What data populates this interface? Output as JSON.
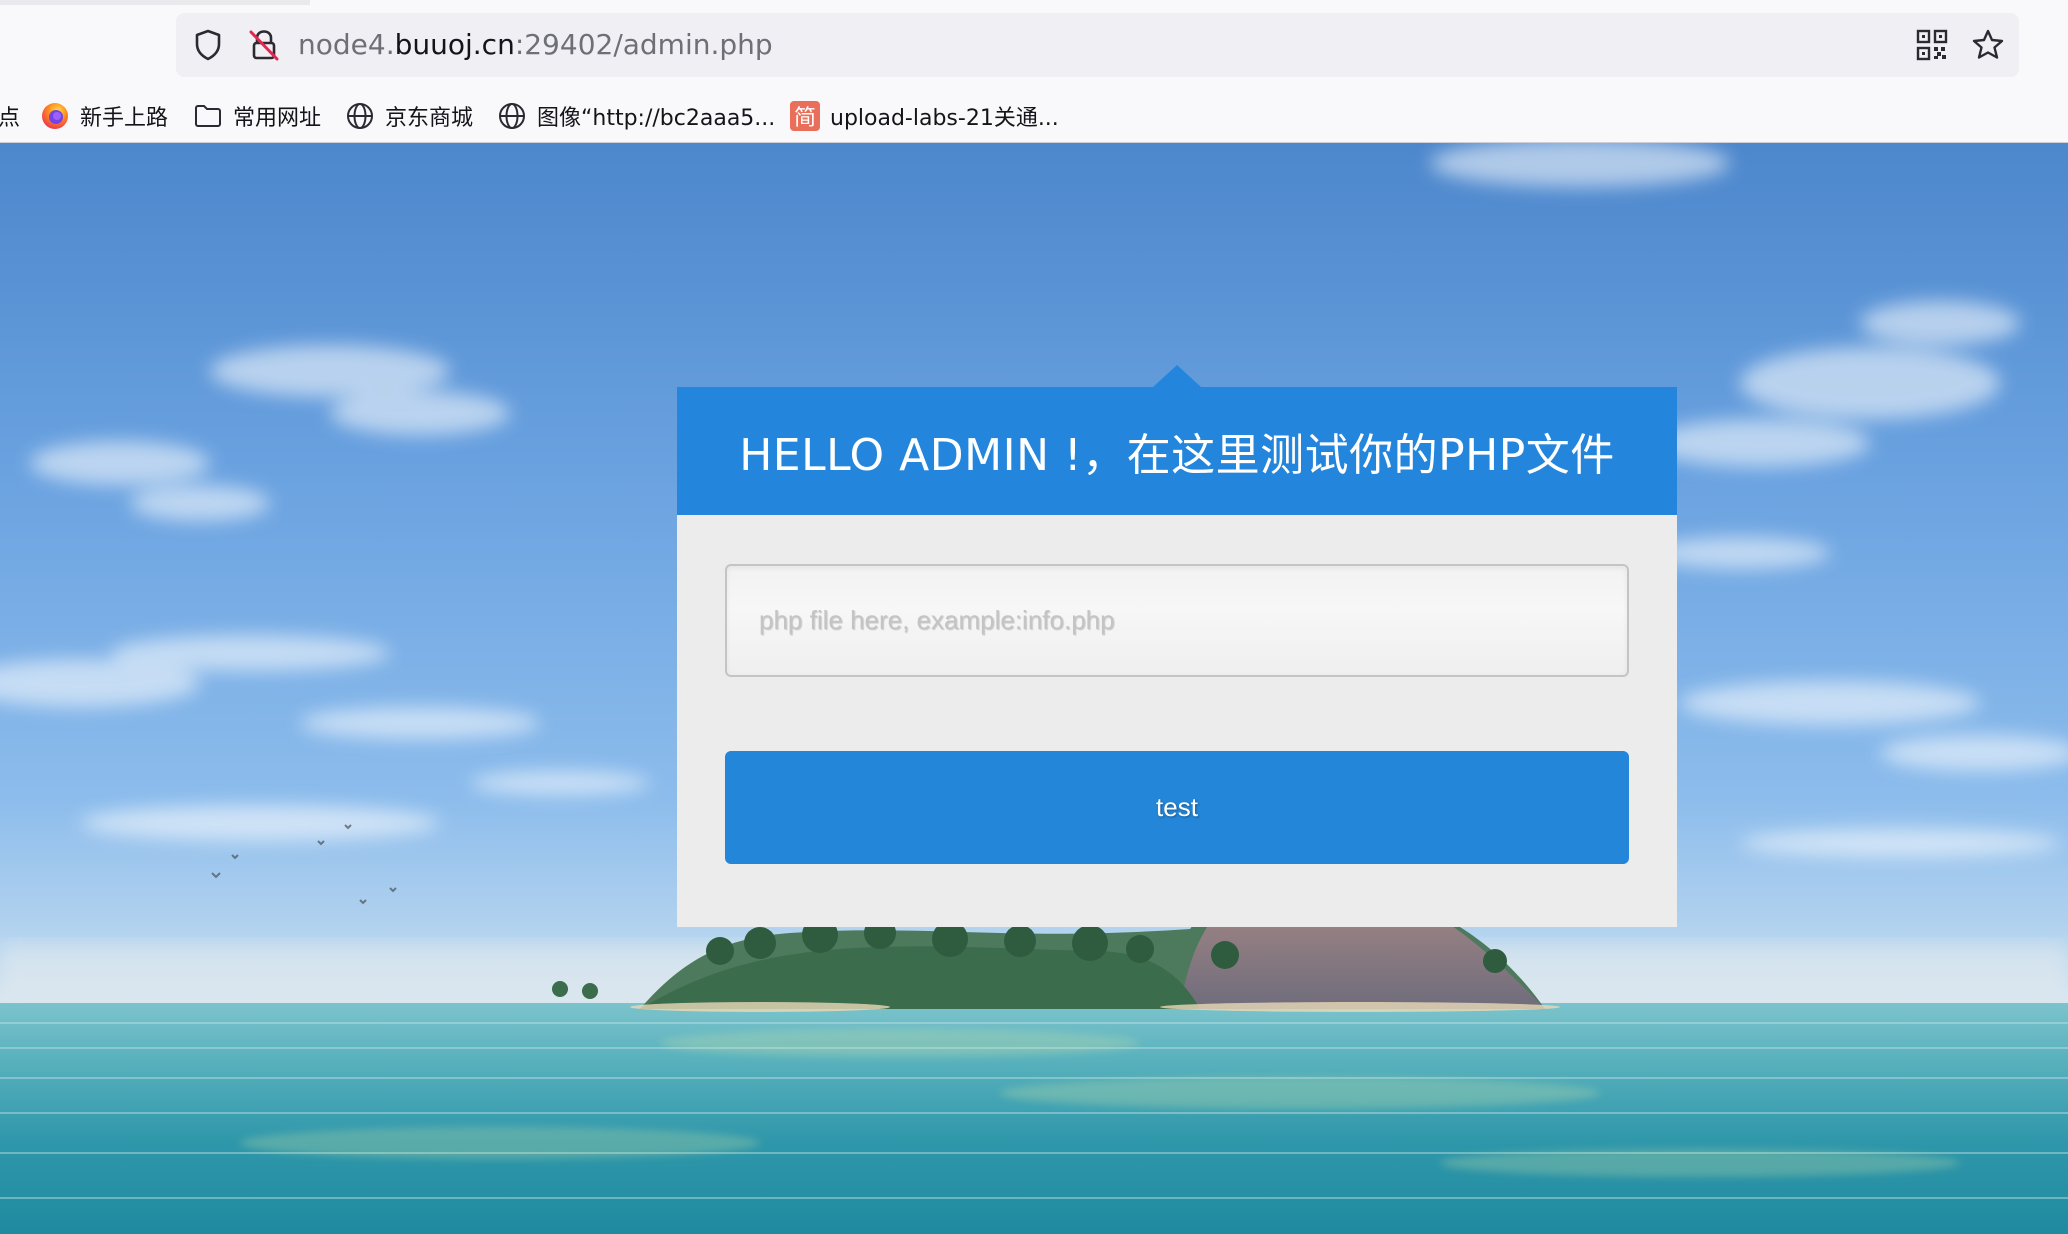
{
  "browser": {
    "url_prefix": "node4.",
    "url_host": "buuoj.cn",
    "url_suffix": ":29402/admin.php",
    "bookmarks": [
      {
        "label": "点",
        "icon": "truncated-item"
      },
      {
        "label": "新手上路",
        "icon": "firefox-icon"
      },
      {
        "label": "常用网址",
        "icon": "folder-icon"
      },
      {
        "label": "京东商城",
        "icon": "globe-icon"
      },
      {
        "label": "图像“http://bc2aaa5...",
        "icon": "globe-icon"
      },
      {
        "label": "upload-labs-21关通...",
        "icon": "jianshu-icon",
        "icon_char": "简"
      }
    ],
    "toolbar_icons": [
      "shield-icon",
      "insecure-lock-icon",
      "qr-code-icon",
      "bookmark-star-icon"
    ]
  },
  "panel": {
    "title": "HELLO ADMIN !，在这里测试你的PHP文件",
    "input_placeholder": "php file here, example:info.php",
    "input_value": "",
    "button_label": "test"
  },
  "colors": {
    "accent": "#2386dc",
    "panel_body": "#ececec"
  }
}
